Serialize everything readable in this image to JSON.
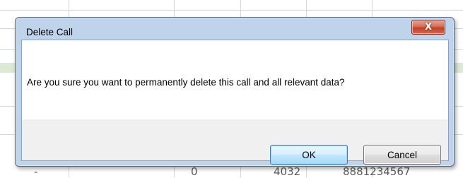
{
  "dialog": {
    "title": "Delete Call",
    "close_glyph": "X",
    "close_icon": "close-icon",
    "message": "Are you sure you want to permanently delete this call and all relevant data?",
    "buttons": {
      "ok_label": "OK",
      "cancel_label": "Cancel"
    }
  },
  "background": {
    "row_values": [
      "-",
      "0",
      "4032",
      "8881234567"
    ]
  },
  "colors": {
    "ok_border": "#3c7fb1",
    "close_button": "#c0412a",
    "frame": "#bfd3ea"
  }
}
